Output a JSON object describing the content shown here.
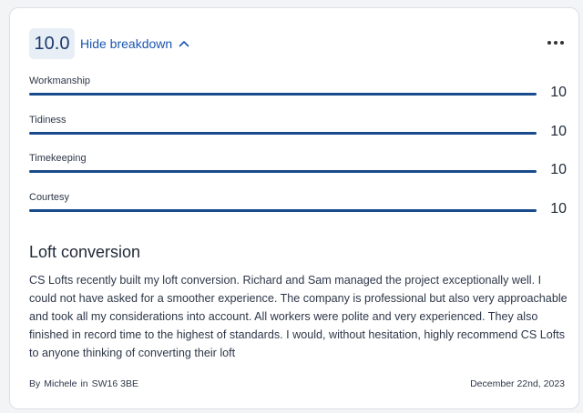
{
  "review": {
    "overall_score": "10.0",
    "toggle_label": "Hide breakdown",
    "more_icon": "more-horizontal-icon",
    "ratings": [
      {
        "label": "Workmanship",
        "value": "10",
        "fraction": 1.0
      },
      {
        "label": "Tidiness",
        "value": "10",
        "fraction": 1.0
      },
      {
        "label": "Timekeeping",
        "value": "10",
        "fraction": 1.0
      },
      {
        "label": "Courtesy",
        "value": "10",
        "fraction": 1.0
      }
    ],
    "title": "Loft conversion",
    "body": "CS Lofts recently built my loft conversion.  Richard and Sam managed the project exceptionally well.  I could not have asked for a smoother experience.  The company is professional but also very approachable and took all my considerations into account.  All workers were polite and very experienced.  They also finished in record time to the highest of standards.   I would, without hesitation, highly recommend CS Lofts to anyone thinking of converting their loft",
    "author_prefix": "By",
    "author_name": "Michele",
    "location_prefix": "in",
    "location": "SW16 3BE",
    "date": "December 22nd, 2023"
  },
  "colors": {
    "accent": "#1a56b0",
    "bar": "#184a8c",
    "badge_bg": "#e8eef6"
  }
}
